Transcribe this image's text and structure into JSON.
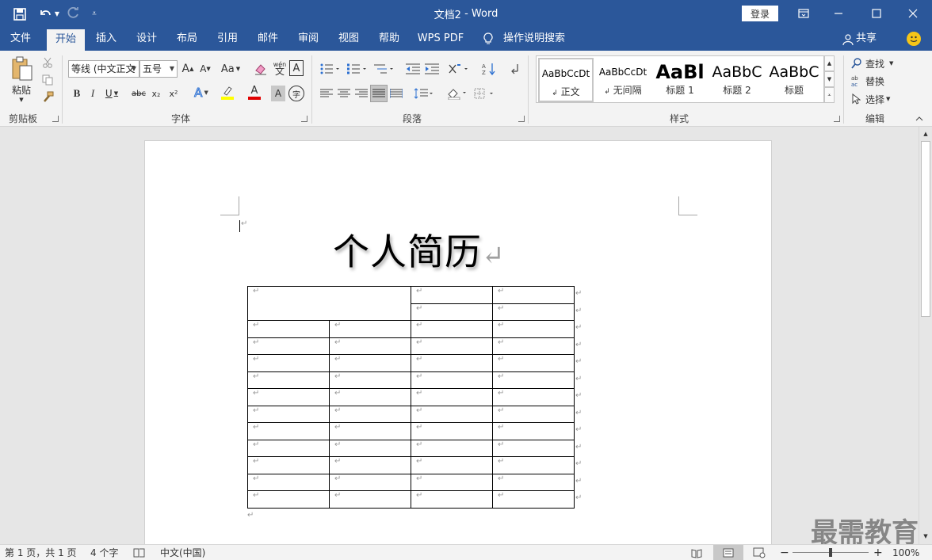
{
  "window": {
    "title": "文档2",
    "separator": "-",
    "app": "Word",
    "login_label": "登录"
  },
  "ribbon_tabs": [
    "文件",
    "开始",
    "插入",
    "设计",
    "布局",
    "引用",
    "邮件",
    "审阅",
    "视图",
    "帮助",
    "WPS PDF",
    "操作说明搜索"
  ],
  "share_label": "共享",
  "clipboard": {
    "paste_label": "粘贴",
    "group_label": "剪贴板"
  },
  "font": {
    "family": "等线 (中文正文",
    "size": "五号",
    "group_label": "字体",
    "b": "B",
    "i": "I",
    "u": "U",
    "strike": "abc",
    "sub": "x₂",
    "sup": "x²",
    "grow": "A",
    "shrink": "A",
    "aa": "Aa",
    "wen": "wén",
    "boxA": "A",
    "fontA": "A",
    "shadeA": "A",
    "circ": "字"
  },
  "paragraph": {
    "group_label": "段落"
  },
  "styles": {
    "group_label": "样式",
    "items": [
      {
        "preview": "AaBbCcDt",
        "name": "正文"
      },
      {
        "preview": "AaBbCcDt",
        "name": "无间隔"
      },
      {
        "preview": "AaBl",
        "name": "标题 1"
      },
      {
        "preview": "AaBbC",
        "name": "标题 2"
      },
      {
        "preview": "AaBbC",
        "name": "标题"
      }
    ]
  },
  "editing": {
    "find": "查找",
    "replace": "替换",
    "select": "选择",
    "group_label": "编辑"
  },
  "document": {
    "title": "个人简历",
    "para_mark": "↵"
  },
  "status": {
    "page": "第 1 页，共 1 页",
    "words": "4 个字",
    "lang": "中文(中国)",
    "zoom": "100%",
    "minus": "−",
    "plus": "+"
  },
  "watermark": "最需教育",
  "colors": {
    "accent": "#2b579a",
    "highlight": "#ffff00",
    "font_color": "#e00000"
  }
}
